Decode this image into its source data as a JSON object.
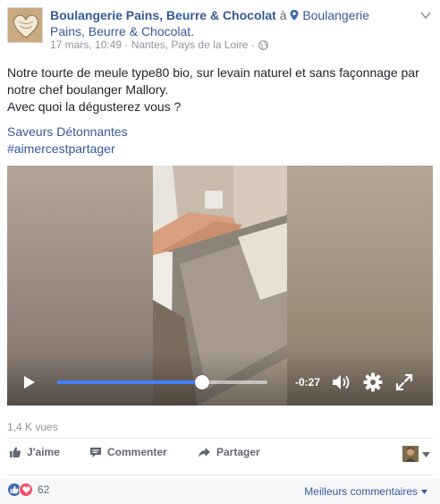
{
  "post": {
    "page_name": "Boulangerie Pains, Beurre & Chocolat",
    "at_word": "à",
    "location_line1": "Boulangerie",
    "location_line2": "Pains, Beurre & Chocolat.",
    "meta": "17 mars, 10:49 · Nantes, Pays de la Loire ·",
    "text_line1": "Notre tourte de meule type80 bio, sur levain naturel et sans façonnage par",
    "text_line2": "notre chef boulanger Mallory.",
    "text_line3": "Avec quoi la dégusterez vous ?",
    "hashtags": [
      "Saveurs Détonnantes",
      "#aimercestpartager"
    ]
  },
  "video": {
    "time_remaining": "-0:27",
    "progress": 0.69
  },
  "views": "1,4 K vues",
  "actions": {
    "like": "J'aime",
    "comment": "Commenter",
    "share": "Partager"
  },
  "footer": {
    "reaction_count": "62",
    "sort_label": "Meilleurs commentaires"
  },
  "colors": {
    "link": "#365899",
    "meta": "#90949c",
    "progress": "#4080ff",
    "like_blue": "#4267b2",
    "love_red": "#f25268"
  },
  "icons": [
    "heart-bread-logo",
    "map-pin-icon",
    "globe-icon",
    "chevron-down-icon",
    "play-icon",
    "volume-icon",
    "gear-icon",
    "fullscreen-icon",
    "thumbs-up-icon",
    "comment-icon",
    "share-icon",
    "heart-icon"
  ]
}
